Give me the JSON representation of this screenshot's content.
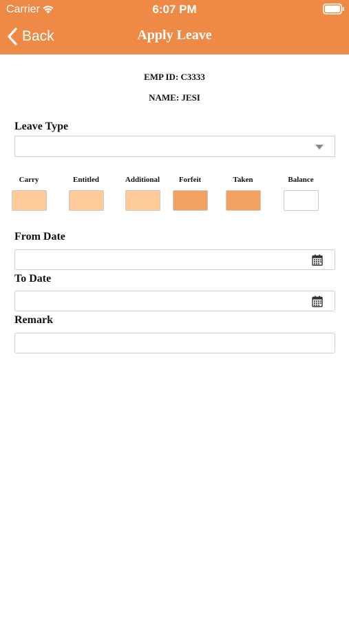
{
  "status_bar": {
    "carrier": "Carrier",
    "time": "6:07 PM"
  },
  "nav": {
    "back_label": "Back",
    "title": "Apply Leave"
  },
  "employee": {
    "emp_id": "EMP ID: C3333",
    "name": "NAME: JESI"
  },
  "form": {
    "leave_type_label": "Leave Type",
    "leave_type_value": "",
    "from_date_label": "From Date",
    "from_date_value": "",
    "to_date_label": "To Date",
    "to_date_value": "",
    "remark_label": "Remark",
    "remark_value": ""
  },
  "balances": [
    {
      "label": "Carry",
      "value": "",
      "color": "#FFCC99"
    },
    {
      "label": "Entitled",
      "value": "",
      "color": "#FFCC99"
    },
    {
      "label": "Additional",
      "value": "",
      "color": "#FFCC99"
    },
    {
      "label": "Forfeit",
      "value": "",
      "color": "#F4A261"
    },
    {
      "label": "Taken",
      "value": "",
      "color": "#F4A261"
    },
    {
      "label": "Balance",
      "value": "",
      "color": "#FFFFFF"
    }
  ],
  "icons": {
    "wifi": "wifi-icon",
    "battery": "battery-icon",
    "back": "chevron-left-icon",
    "dropdown": "chevron-down-icon",
    "calendar": "calendar-icon"
  },
  "colors": {
    "header": "#EE8A46",
    "header_text": "#FFFFFF"
  }
}
